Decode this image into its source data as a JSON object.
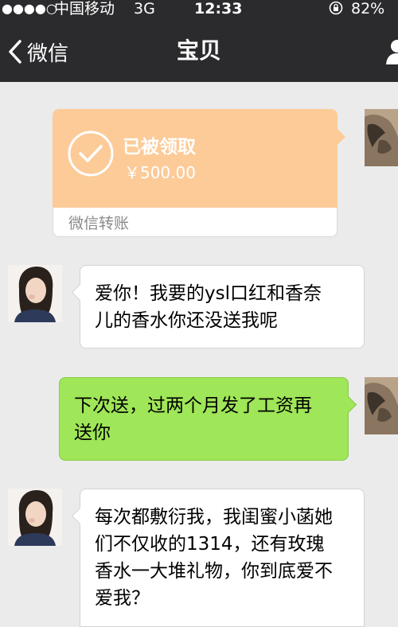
{
  "status_bar": {
    "signal": "●●●●○",
    "carrier": "中国移动",
    "network": "3G",
    "time": "12:33",
    "battery": "82%"
  },
  "nav": {
    "back_label": "微信",
    "title": "宝贝"
  },
  "transfer": {
    "status": "已被领取",
    "amount": "￥500.00",
    "source_label": "微信转账",
    "color": "#fccb98"
  },
  "messages": [
    {
      "sender": "her",
      "text": "爱你！我要的ysl口红和香奈\n儿的香水你还没送我呢"
    },
    {
      "sender": "me",
      "text": "下次送，过两个月发了工资再\n送你"
    },
    {
      "sender": "her",
      "text": "每次都敷衍我，我闺蜜小菡她\n们不仅收的1314，还有玫瑰\n香水一大堆礼物，你到底爱不\n爱我？"
    }
  ],
  "colors": {
    "nav_bg": "#2b2b2d",
    "chat_bg": "#ebebeb",
    "my_bubble": "#9fe658",
    "her_bubble": "#ffffff"
  },
  "icons": {
    "back": "chevron-left-icon",
    "user": "user-icon",
    "lock": "rotation-lock-icon",
    "check": "check-circle-icon"
  }
}
